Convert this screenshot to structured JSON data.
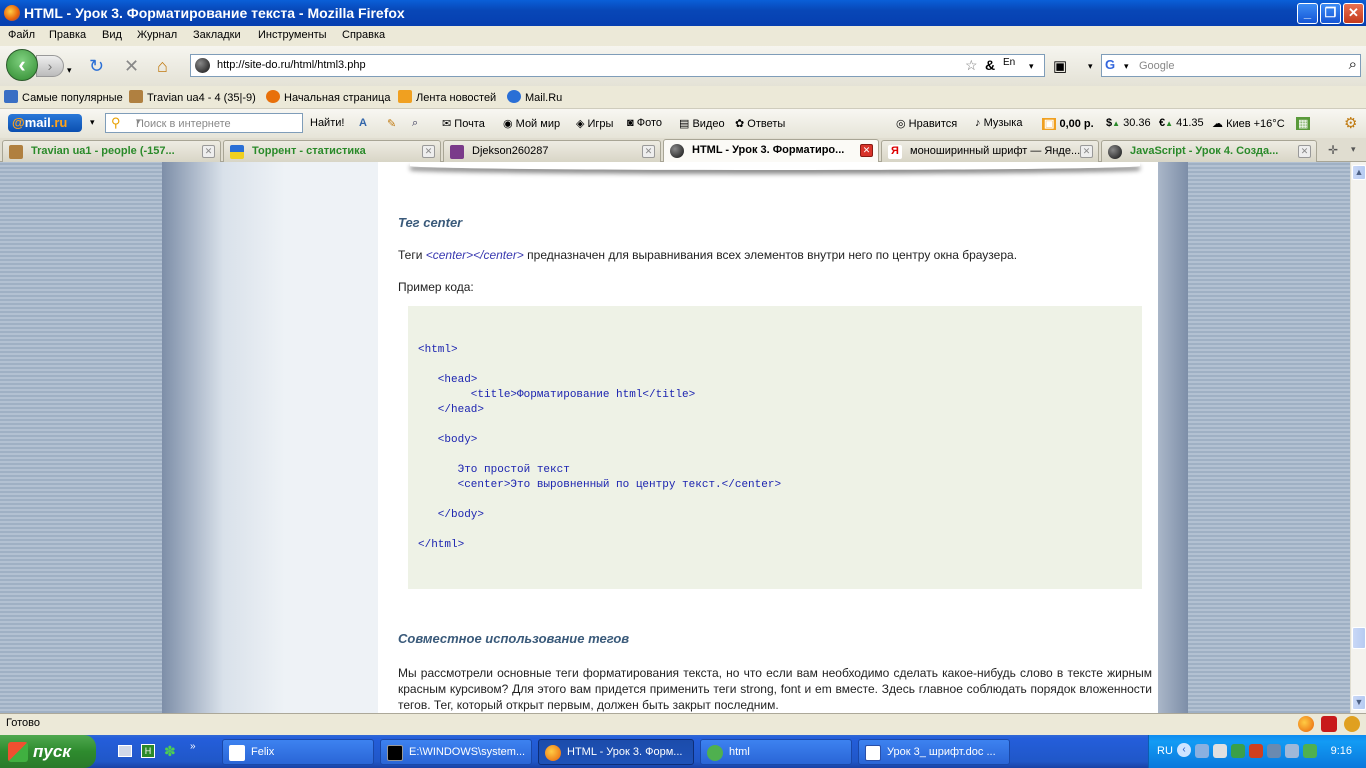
{
  "window": {
    "title": "HTML - Урок 3. Форматирование текста - Mozilla Firefox",
    "min": "_",
    "max": "❐",
    "close": "✕"
  },
  "menu": [
    "Файл",
    "Правка",
    "Вид",
    "Журнал",
    "Закладки",
    "Инструменты",
    "Справка"
  ],
  "nav": {
    "url": "http://site-do.ru/html/html3.php",
    "search_placeholder": "Google"
  },
  "bookmarks": [
    "Самые популярные",
    "Travian ua4 - 4 (35|-9)",
    "Начальная страница",
    "Лента новостей",
    "Mail.Ru"
  ],
  "mailbar": {
    "logo_at": "@",
    "logo_mail": "mail",
    "logo_ru": ".ru",
    "search_placeholder": "Поиск в интернете",
    "find": "Найти!",
    "links": [
      "Почта",
      "Мой мир",
      "Игры",
      "Фото",
      "Видео",
      "Ответы",
      "Нравится",
      "Музыка"
    ],
    "balance": "0,00 р.",
    "usd": "30.36",
    "eur": "41.35",
    "weather": "Киев +16°C"
  },
  "tabs": [
    {
      "label": "Travian ua1 - people (-157...",
      "color": "#2a8a2a"
    },
    {
      "label": "Торрент - статистика",
      "color": "#2a8a2a"
    },
    {
      "label": "Djekson260287",
      "color": "#000000"
    },
    {
      "label": "HTML - Урок 3. Форматиро...",
      "color": "#000000"
    },
    {
      "label": "моноширинный шрифт — Янде...",
      "color": "#000000"
    },
    {
      "label": "JavaScript - Урок 4. Созда...",
      "color": "#2a8a2a"
    }
  ],
  "content": {
    "heading1": "Тег center",
    "para1_before": "Теги ",
    "para1_tag": "<center></center>",
    "para1_after": " предназначен для выравнивания всех элементов внутри него по центру окна браузера.",
    "para2": "Пример кода:",
    "code": "<html>\n\n   <head>\n        <title>Форматирование html</title>\n   </head>\n\n   <body>\n\n      Это простой текст\n      <center>Это выровненный по центру текст.</center>\n\n   </body>\n\n</html>",
    "heading2": "Совместное использование тегов",
    "para3": "Мы рассмотрели основные теги форматирования текста, но что если вам необходимо сделать какое-нибудь слово в тексте жирным красным курсивом? Для этого вам придется применить теги strong, font и em вместе. Здесь главное соблюдать порядок вложенности тегов. Тег, который открыт первым, должен быть закрыт последним."
  },
  "status": "Готово",
  "taskbar": {
    "start": "пуск",
    "items": [
      "Felix",
      "E:\\WINDOWS\\system...",
      "HTML - Урок 3. Форм...",
      "html",
      "Урок 3_ шрифт.doc ..."
    ],
    "lang": "RU",
    "clock": "9:16"
  }
}
